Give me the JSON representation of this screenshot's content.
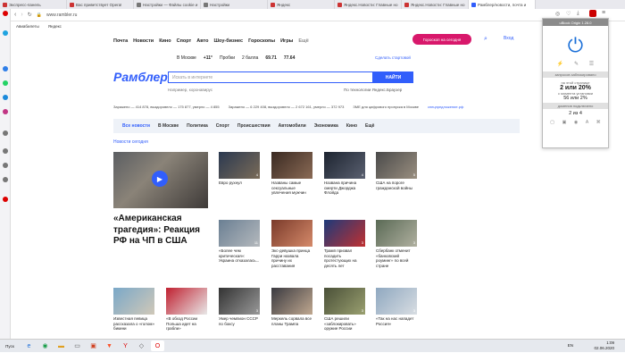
{
  "browser": {
    "tabs": [
      {
        "label": "Экспресс-панель",
        "color": "#d33"
      },
      {
        "label": "Вас приветствует Opera!",
        "color": "#d33"
      },
      {
        "label": "Настройки — Файлы cookie и",
        "color": "#777"
      },
      {
        "label": "Настройки",
        "color": "#777"
      },
      {
        "label": "Яндекс",
        "color": "#d33"
      },
      {
        "label": "Яндекс.Новости: Главные но",
        "color": "#d33"
      },
      {
        "label": "Яндекс.Новости: Главные но",
        "color": "#d33"
      },
      {
        "label": "Рамблер/новости, почта и",
        "color": "#315efb"
      }
    ],
    "url": "www.rambler.ru",
    "bookmarks": [
      "Авиабилеты",
      "Яндекс"
    ]
  },
  "rambler": {
    "topnav": [
      "Почта",
      "Новости",
      "Кино",
      "Спорт",
      "Авто",
      "Шоу-бизнес",
      "Гороскопы",
      "Игры",
      "Ещё"
    ],
    "horoscope_button": "Гороскоп на сегодня",
    "login": "Вход",
    "logo": "Рамблер/",
    "weather": {
      "city": "В Москве",
      "temp": "+11°",
      "traffic": "Пробки",
      "traffic_score": "2 балла",
      "usd": "69.71",
      "eur": "77.64"
    },
    "start_page": "Сделать стартовой",
    "search": {
      "placeholder": "Искать в интернете",
      "button": "НАЙТИ"
    },
    "example": "Например, коронавирус",
    "yandex_note": "По технологии Яндекс.Браузер",
    "covid": [
      "Заражено — 414 878, выздоровело — 175 877, умерло — 4 855",
      "Заражено — 6 229 408, выздоровело — 2 672 161, умерло — 372 973",
      "ЗМЕ для цифрового пропуска в Москве",
      "спецпредложение.рф"
    ],
    "sections": [
      "Все новости",
      "В Москве",
      "Политика",
      "Спорт",
      "Происшествия",
      "Автомобили",
      "Экономика",
      "Кино",
      "Ещё"
    ],
    "news_today": "Новости сегодня",
    "big_title": "«Американская трагедия»: Реакция РФ на ЧП в США",
    "cards_row1": [
      {
        "caption": "Евро рухнул",
        "count": "4"
      },
      {
        "caption": "Названы самые сексуальные увлечения мужчин",
        "count": ""
      },
      {
        "caption": "Названа причина смерти Джорджа Флойда",
        "count": "4"
      },
      {
        "caption": "США на пороге гражданской войны",
        "count": "5"
      }
    ],
    "cards_row2": [
      {
        "caption": "«Более чем критическая»: Украина отказалась...",
        "count": "11"
      },
      {
        "caption": "Экс-девушка принца Гарри назвала причину их расставания",
        "count": ""
      },
      {
        "caption": "Трамп призвал посадить протестующих на десять лет",
        "count": "3"
      },
      {
        "caption": "Сбербанк отменит «банковский роуминг» по всей стране",
        "count": "3"
      }
    ],
    "cards_row3": [
      {
        "caption": "Известная певица рассказала о «голом» бикини",
        "count": ""
      },
      {
        "caption": "«В обход России Польша идет на грабли»",
        "count": ""
      },
      {
        "caption": "Умер чемпион СССР по боксу",
        "count": "3"
      },
      {
        "caption": "Меркель сорвала все планы Трампа",
        "count": ""
      },
      {
        "caption": "США решили «заблокировать» оружие России",
        "count": "3"
      },
      {
        "caption": "«Так на нас нападет Россия»",
        "count": "3"
      }
    ]
  },
  "ublock": {
    "header": "uBlock Origin 1.28.0",
    "blocked_label": "запросов заблокировано",
    "page_label": "на этой странице",
    "page_value": "2 или 20%",
    "install_label": "с момента установки",
    "install_value": "56 или 2%",
    "domains_label": "доменов подключено",
    "domains_value": "2 из 4"
  },
  "taskbar": {
    "start": "Пуск",
    "lang": "EN",
    "time": "1:09",
    "date": "02.06.2020"
  }
}
